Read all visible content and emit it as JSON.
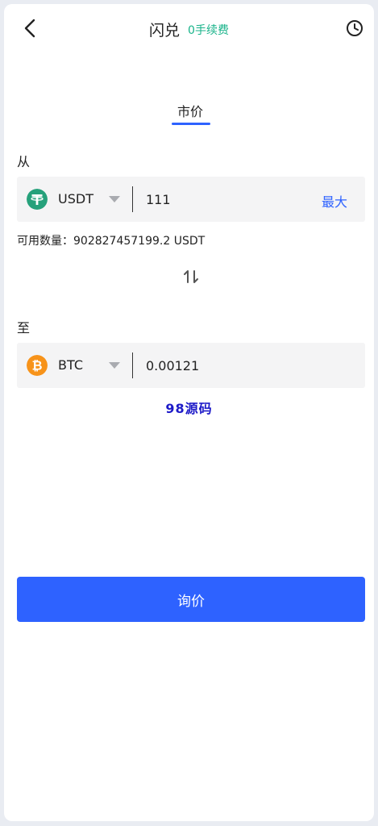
{
  "header": {
    "title": "闪兑",
    "fee_badge": "0手续费",
    "back_icon": "chevron-left-icon",
    "history_icon": "clock-icon"
  },
  "tabs": [
    {
      "label": "市价",
      "active": true
    }
  ],
  "from": {
    "label": "从",
    "coin": "USDT",
    "coin_icon": "tether-icon",
    "coin_color": "#26a17b",
    "amount": "111",
    "max_label": "最大",
    "available_label": "可用数量：",
    "available_value": "902827457199.2 USDT"
  },
  "swap_icon": "swap-vertical-icon",
  "to": {
    "label": "至",
    "coin": "BTC",
    "coin_icon": "bitcoin-icon",
    "coin_color": "#f7931a",
    "amount": "0.00121"
  },
  "watermark": "98源码",
  "action": {
    "quote_label": "询价"
  },
  "colors": {
    "accent": "#2e62ff",
    "fee_green": "#19b38a",
    "field_bg": "#f4f4f5"
  }
}
